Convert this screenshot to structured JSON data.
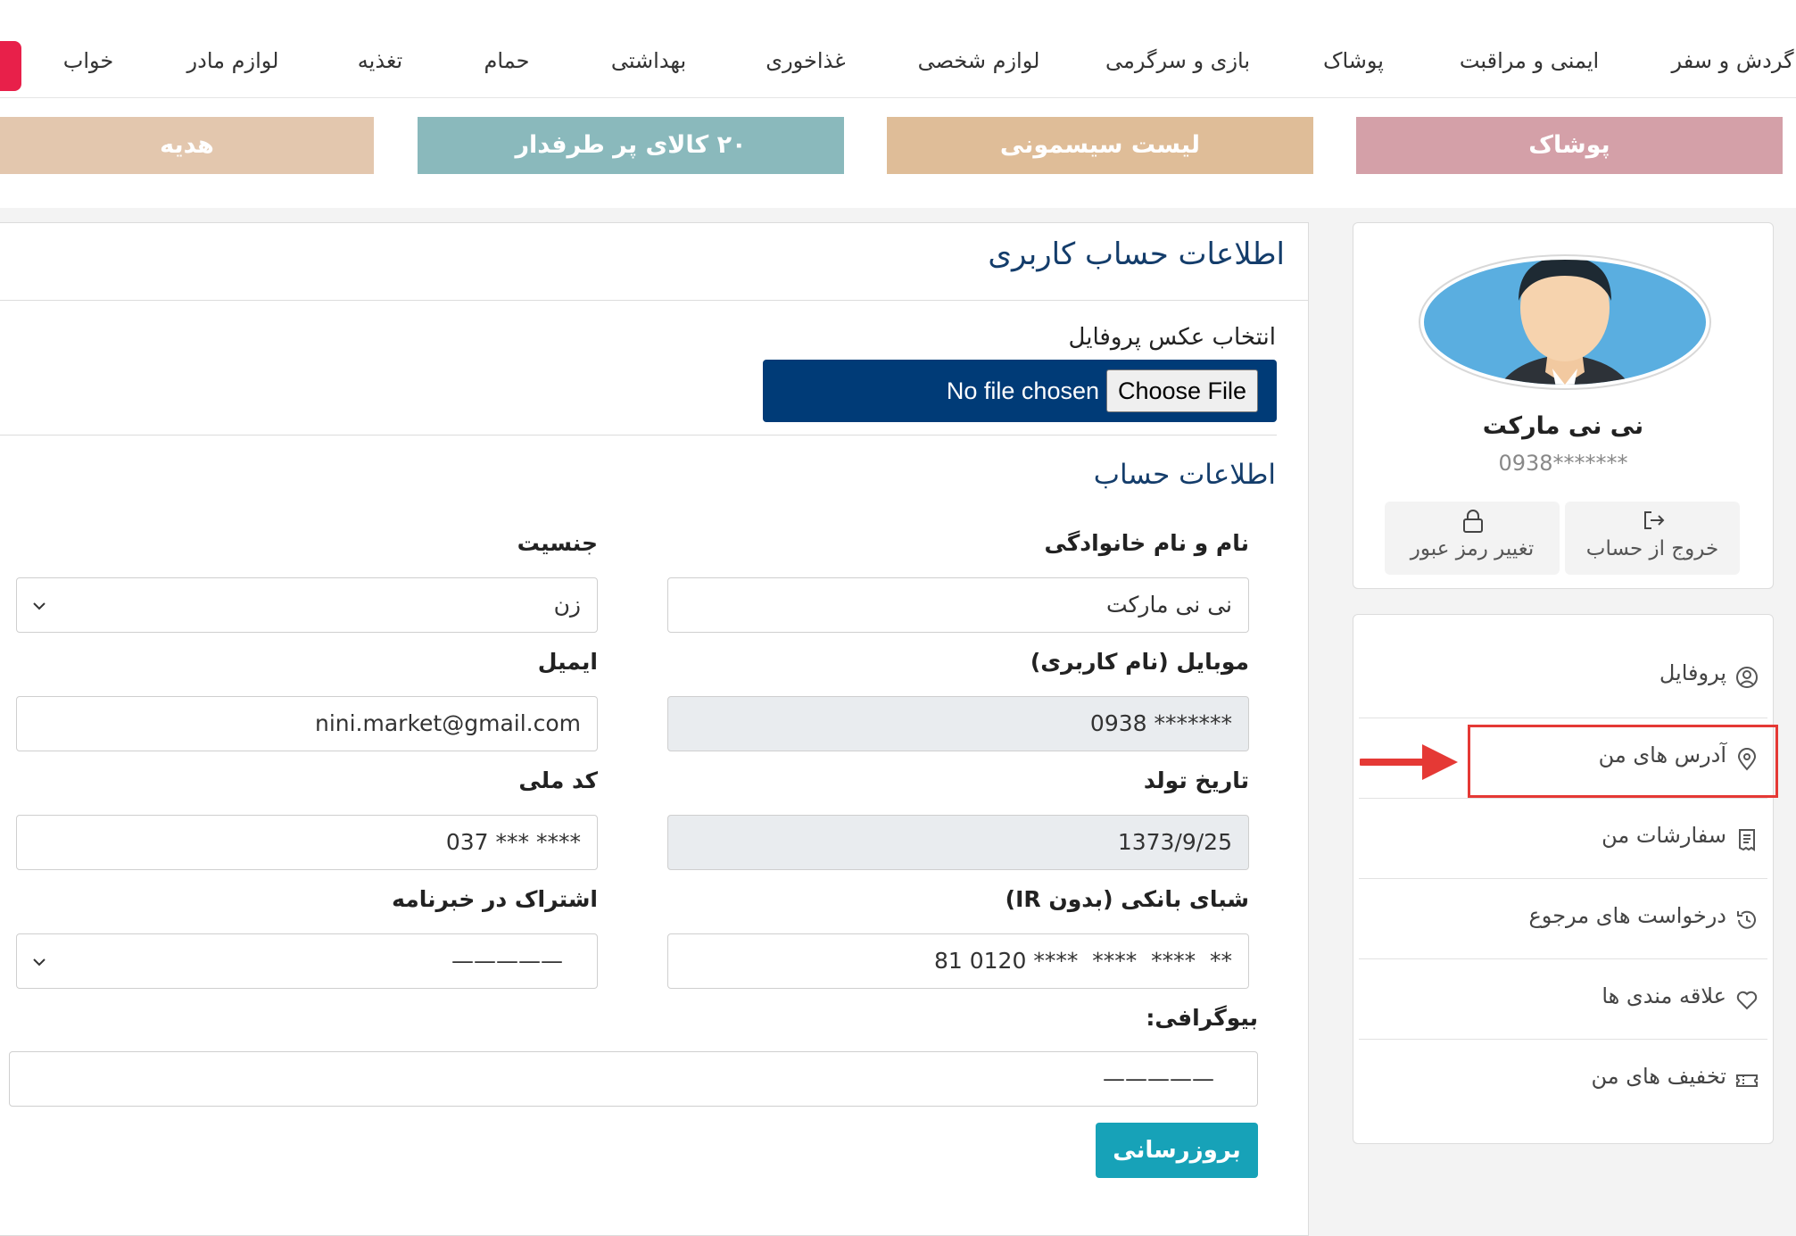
{
  "nav": {
    "items": [
      {
        "label": "گردش و سفر"
      },
      {
        "label": "ایمنی و مراقبت"
      },
      {
        "label": "پوشاک"
      },
      {
        "label": "بازی و سرگرمی"
      },
      {
        "label": "لوازم شخصی"
      },
      {
        "label": "غذاخوری"
      },
      {
        "label": "بهداشتی"
      },
      {
        "label": "حمام"
      },
      {
        "label": "تغذیه"
      },
      {
        "label": "لوازم مادر"
      },
      {
        "label": "خواب"
      }
    ]
  },
  "categories": [
    {
      "label": "پوشاک",
      "color": "#d4a0a8"
    },
    {
      "label": "لیست سیسمونی",
      "color": "#dfbd98"
    },
    {
      "label": "۲۰ کالای پر طرفدار",
      "color": "#8ab9bc"
    },
    {
      "label": "هدیه",
      "color": "#e3c7ae"
    }
  ],
  "profile": {
    "name": "نی نی مارکت",
    "phone": "0938*******",
    "change_password": "تغییر رمز عبور",
    "logout": "خروج از حساب"
  },
  "menu": {
    "items": [
      {
        "label": "پروفایل",
        "icon": "user-circle-icon"
      },
      {
        "label": "آدرس های من",
        "icon": "map-pin-icon"
      },
      {
        "label": "سفارشات من",
        "icon": "receipt-icon"
      },
      {
        "label": "درخواست های مرجوع",
        "icon": "history-icon"
      },
      {
        "label": "علاقه مندی ها",
        "icon": "heart-icon"
      },
      {
        "label": "تخفیف های من",
        "icon": "ticket-icon"
      }
    ]
  },
  "main": {
    "title": "اطلاعات حساب کاربری",
    "photo_label": "انتخاب عکس پروفایل",
    "choose_file": "Choose File",
    "no_file": "No file chosen",
    "section_title": "اطلاعات حساب",
    "fields": {
      "fullname": {
        "label": "نام و نام خانوادگی",
        "value": "نی نی مارکت"
      },
      "gender": {
        "label": "جنسیت",
        "value": "زن"
      },
      "mobile": {
        "label": "موبایل (نام کاربری)",
        "value": "0938 *******"
      },
      "email": {
        "label": "ایمیل",
        "value": "nini.market@gmail.com"
      },
      "birthdate": {
        "label": "تاریخ تولد",
        "value": "1373/9/25"
      },
      "national_code": {
        "label": "کد ملی",
        "value": "037 *** ****"
      },
      "sheba": {
        "label": "شبای بانکی (بدون IR)",
        "value": "81 0120 ****  ****  ****  **"
      },
      "newsletter": {
        "label": "اشتراک در خبرنامه",
        "value": "—————"
      },
      "bio": {
        "label": "بیوگرافی:",
        "value": "—————"
      }
    },
    "submit": "بروزرسانی"
  }
}
